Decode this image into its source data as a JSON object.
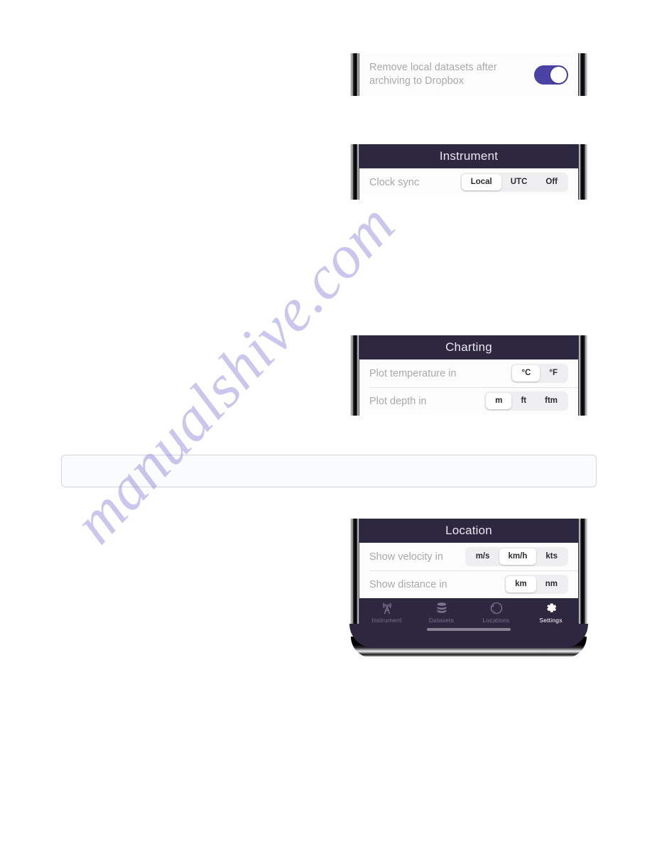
{
  "page": {
    "watermark": "manualshive.com"
  },
  "panels": [
    {
      "id": "dropbox",
      "header": null,
      "rows": [
        {
          "label": "Remove local datasets after archiving to Dropbox",
          "control": "toggle",
          "toggle_on": true
        }
      ]
    },
    {
      "id": "instrument",
      "header": "Instrument",
      "rows": [
        {
          "label": "Clock sync",
          "control": "segmented",
          "options": [
            "Local",
            "UTC",
            "Off"
          ],
          "selected": "Local"
        }
      ]
    },
    {
      "id": "charting",
      "header": "Charting",
      "rows": [
        {
          "label": "Plot temperature in",
          "control": "segmented",
          "options": [
            "°C",
            "°F"
          ],
          "selected": "°C"
        },
        {
          "label": "Plot depth in",
          "control": "segmented",
          "options": [
            "m",
            "ft",
            "ftm"
          ],
          "selected": "m"
        }
      ]
    },
    {
      "id": "location",
      "header": "Location",
      "rows": [
        {
          "label": "Show velocity in",
          "control": "segmented",
          "options": [
            "m/s",
            "km/h",
            "kts"
          ],
          "selected": "km/h"
        },
        {
          "label": "Show distance in",
          "control": "segmented",
          "options": [
            "km",
            "nm"
          ],
          "selected": "km"
        }
      ]
    }
  ],
  "tabbar": {
    "tabs": [
      {
        "label": "Instrument",
        "icon": "broadcast-tower-icon",
        "active": false
      },
      {
        "label": "Datasets",
        "icon": "database-stack-icon",
        "active": false
      },
      {
        "label": "Locations",
        "icon": "globe-icon",
        "active": false
      },
      {
        "label": "Settings",
        "icon": "gear-icon",
        "active": true
      }
    ]
  },
  "colors": {
    "header_bg": "#2e2740",
    "toggle_on": "#4b42a6",
    "row_label": "#a9a9ad",
    "segment_track": "#efeff1",
    "watermark": "#7b74d6"
  }
}
